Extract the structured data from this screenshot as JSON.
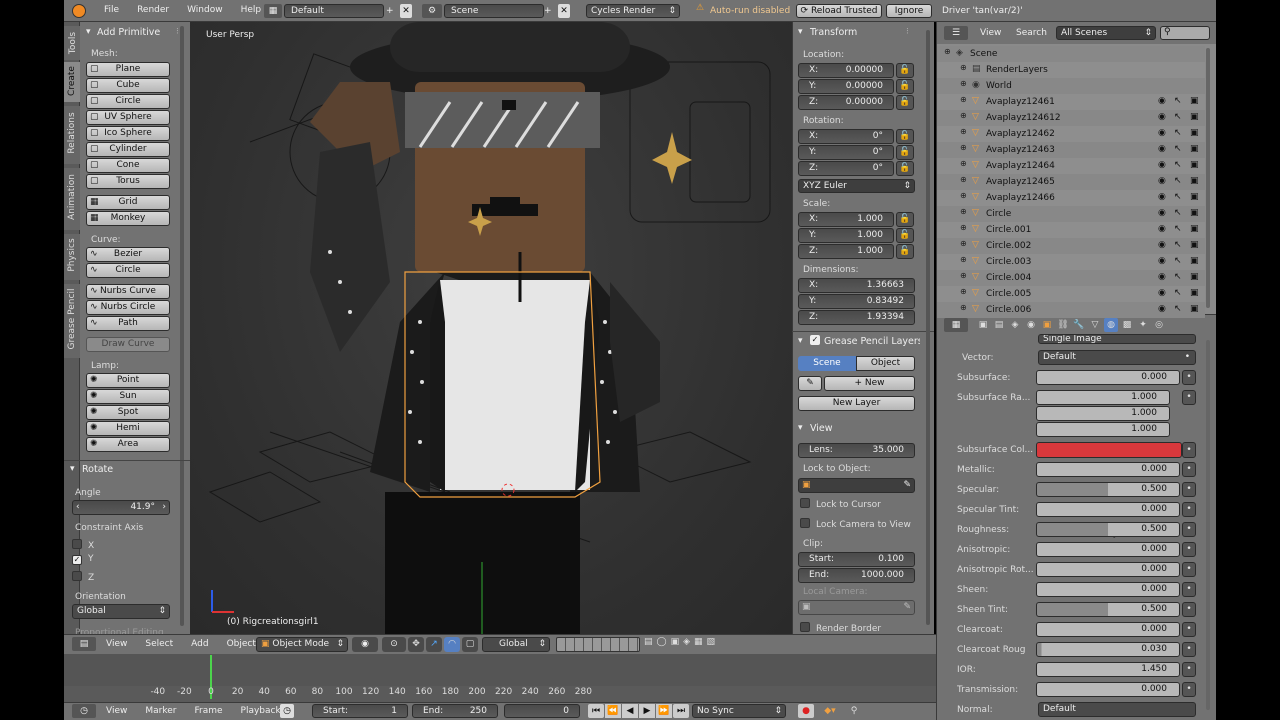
{
  "topbar": {
    "menus": [
      "File",
      "Render",
      "Window",
      "Help"
    ],
    "screen": "Default",
    "scene": "Scene",
    "engine": "Cycles Render",
    "warning": "Auto-run disabled",
    "reload": "Reload Trusted",
    "ignore": "Ignore",
    "driver": "Driver 'tan(var/2)'"
  },
  "vtabs": [
    "Tools",
    "Create",
    "Relations",
    "Animation",
    "Physics",
    "Grease Pencil"
  ],
  "toolshelf": {
    "title": "Add Primitive",
    "mesh_label": "Mesh:",
    "mesh": [
      "Plane",
      "Cube",
      "Circle",
      "UV Sphere",
      "Ico Sphere",
      "Cylinder",
      "Cone",
      "Torus"
    ],
    "mesh2": [
      "Grid",
      "Monkey"
    ],
    "curve_label": "Curve:",
    "curve": [
      "Bezier",
      "Circle"
    ],
    "curve2": [
      "Nurbs Curve",
      "Nurbs Circle",
      "Path"
    ],
    "draw_curve": "Draw Curve",
    "lamp_label": "Lamp:",
    "lamp": [
      "Point",
      "Sun",
      "Spot",
      "Hemi",
      "Area"
    ]
  },
  "operator": {
    "title": "Rotate",
    "angle_label": "Angle",
    "angle": "41.9°",
    "axis_label": "Constraint Axis",
    "axes": [
      "X",
      "Y",
      "Z"
    ],
    "orient_label": "Orientation",
    "orient": "Global",
    "prop": "Proportional Editing"
  },
  "viewport": {
    "label": "User Persp",
    "object": "(0) Rigcreationsgirl1"
  },
  "transform": {
    "title": "Transform",
    "location_label": "Location:",
    "location": [
      [
        "X:",
        "0.00000"
      ],
      [
        "Y:",
        "0.00000"
      ],
      [
        "Z:",
        "0.00000"
      ]
    ],
    "rotation_label": "Rotation:",
    "rotation": [
      [
        "X:",
        "0°"
      ],
      [
        "Y:",
        "0°"
      ],
      [
        "Z:",
        "0°"
      ]
    ],
    "euler": "XYZ Euler",
    "scale_label": "Scale:",
    "scale": [
      [
        "X:",
        "1.000"
      ],
      [
        "Y:",
        "1.000"
      ],
      [
        "Z:",
        "1.000"
      ]
    ],
    "dim_label": "Dimensions:",
    "dimensions": [
      [
        "X:",
        "1.36663"
      ],
      [
        "Y:",
        "0.83492"
      ],
      [
        "Z:",
        "1.93394"
      ]
    ]
  },
  "gp": {
    "title": "Grease Pencil Layers",
    "scene": "Scene",
    "object": "Object",
    "new": "New",
    "new_layer": "New Layer"
  },
  "view": {
    "title": "View",
    "lens_label": "Lens:",
    "lens": "35.000",
    "lock_label": "Lock to Object:",
    "lock_cursor": "Lock to Cursor",
    "lock_camera": "Lock Camera to View",
    "clip_label": "Clip:",
    "start_label": "Start:",
    "start": "0.100",
    "end_label": "End:",
    "end": "1000.000",
    "local_camera": "Local Camera:",
    "render_border": "Render Border"
  },
  "outliner": {
    "view": "View",
    "search": "Search",
    "scenes": "All Scenes",
    "items": [
      {
        "name": "Scene",
        "indent": 0
      },
      {
        "name": "RenderLayers",
        "indent": 1
      },
      {
        "name": "World",
        "indent": 1
      },
      {
        "name": "Avaplayz12461",
        "indent": 1
      },
      {
        "name": "Avaplayz124612",
        "indent": 1
      },
      {
        "name": "Avaplayz12462",
        "indent": 1
      },
      {
        "name": "Avaplayz12463",
        "indent": 1
      },
      {
        "name": "Avaplayz12464",
        "indent": 1
      },
      {
        "name": "Avaplayz12465",
        "indent": 1
      },
      {
        "name": "Avaplayz12466",
        "indent": 1
      },
      {
        "name": "Circle",
        "indent": 1
      },
      {
        "name": "Circle.001",
        "indent": 1
      },
      {
        "name": "Circle.002",
        "indent": 1
      },
      {
        "name": "Circle.003",
        "indent": 1
      },
      {
        "name": "Circle.004",
        "indent": 1
      },
      {
        "name": "Circle.005",
        "indent": 1
      },
      {
        "name": "Circle.006",
        "indent": 1
      }
    ]
  },
  "material": {
    "top": "Single Image",
    "vector_label": "Vector:",
    "vector": "Default",
    "rows": [
      {
        "label": "Subsurface:",
        "value": "0.000",
        "fill": 0
      },
      {
        "label": "Subsurface Ra...",
        "value": "1.000",
        "fill": 0
      },
      {
        "label": "",
        "value": "1.000",
        "fill": 0
      },
      {
        "label": "",
        "value": "1.000",
        "fill": 0
      },
      {
        "label": "Subsurface Col...",
        "value": "",
        "fill": 0
      },
      {
        "label": "Metallic:",
        "value": "0.000",
        "fill": 0
      },
      {
        "label": "Specular:",
        "value": "0.500",
        "fill": 0.5
      },
      {
        "label": "Specular Tint:",
        "value": "0.000",
        "fill": 0
      },
      {
        "label": "Roughness:",
        "value": "0.500",
        "fill": 0.5
      },
      {
        "label": "Anisotropic:",
        "value": "0.000",
        "fill": 0
      },
      {
        "label": "Anisotropic Rot...",
        "value": "0.000",
        "fill": 0
      },
      {
        "label": "Sheen:",
        "value": "0.000",
        "fill": 0
      },
      {
        "label": "Sheen Tint:",
        "value": "0.500",
        "fill": 0.5
      },
      {
        "label": "Clearcoat:",
        "value": "0.000",
        "fill": 0
      },
      {
        "label": "Clearcoat Roug",
        "value": "0.030",
        "fill": 0.03
      },
      {
        "label": "IOR:",
        "value": "1.450",
        "fill": 0
      },
      {
        "label": "Transmission:",
        "value": "0.000",
        "fill": 0
      },
      {
        "label": "Normal:",
        "value": "Default",
        "fill": 0
      }
    ],
    "subsurface_color": "#d9383c"
  },
  "viewheader": {
    "menus": [
      "View",
      "Select",
      "Add",
      "Object"
    ],
    "mode": "Object Mode",
    "orient": "Global"
  },
  "timeline": {
    "ticks": [
      "-40",
      "-20",
      "0",
      "20",
      "40",
      "60",
      "80",
      "100",
      "120",
      "140",
      "160",
      "180",
      "200",
      "220",
      "240",
      "260",
      "280"
    ],
    "menus": [
      "View",
      "Marker",
      "Frame",
      "Playback"
    ],
    "start_label": "Start:",
    "start": "1",
    "end_label": "End:",
    "end": "250",
    "current": "0",
    "sync": "No Sync"
  }
}
